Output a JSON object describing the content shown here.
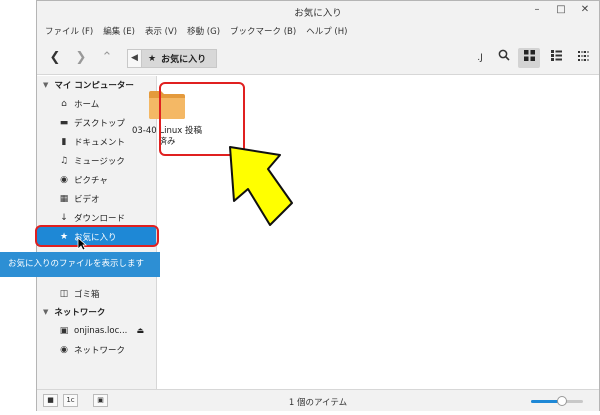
{
  "window": {
    "title": "お気に入り"
  },
  "menu": [
    "ファイル (F)",
    "編集 (E)",
    "表示 (V)",
    "移動 (G)",
    "ブックマーク (B)",
    "ヘルプ (H)"
  ],
  "path": {
    "current": "お気に入り"
  },
  "sidebar": {
    "groups": [
      {
        "label": "マイ コンピューター",
        "items": [
          {
            "label": "ホーム",
            "icon": "home-icon"
          },
          {
            "label": "デスクトップ",
            "icon": "desktop-icon"
          },
          {
            "label": "ドキュメント",
            "icon": "document-icon"
          },
          {
            "label": "ミュージック",
            "icon": "music-icon"
          },
          {
            "label": "ピクチャ",
            "icon": "camera-icon"
          },
          {
            "label": "ビデオ",
            "icon": "video-icon"
          },
          {
            "label": "ダウンロード",
            "icon": "download-icon"
          },
          {
            "label": "お気に入り",
            "icon": "star-icon",
            "selected": true
          },
          {
            "label": "ゴミ箱",
            "icon": "trash-icon"
          }
        ]
      },
      {
        "label": "ネットワーク",
        "items": [
          {
            "label": "onjinas.loc...",
            "icon": "drive-icon"
          },
          {
            "label": "ネットワーク",
            "icon": "globe-icon"
          }
        ]
      }
    ]
  },
  "files": [
    {
      "name": "03-40 Linux 投稿 済み",
      "icon": "folder-icon"
    }
  ],
  "status": {
    "text": "1 個のアイテム",
    "zoom_level": 0.6
  },
  "tooltip": {
    "text": "お気に入りのファイルを表示します"
  },
  "colors": {
    "accent": "#1e88d6",
    "folder": "#f0b35c",
    "highlight": "#e02020",
    "arrow": "#ffff00"
  }
}
